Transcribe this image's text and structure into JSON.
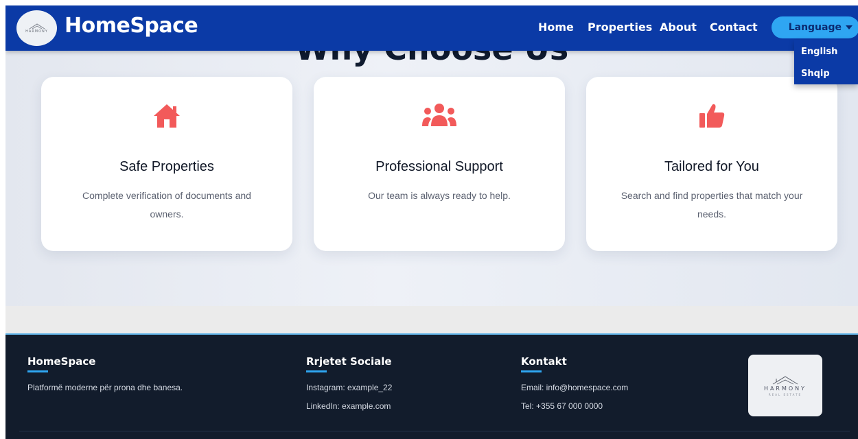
{
  "navbar": {
    "logo_text": "HARMONY",
    "brand": "HomeSpace",
    "links": [
      "Home",
      "Properties",
      "About",
      "Contact"
    ],
    "language_button": "Language",
    "language_options": [
      "English",
      "Shqip"
    ]
  },
  "section": {
    "title": "Why Choose Us",
    "cards": [
      {
        "icon": "home-icon",
        "title": "Safe Properties",
        "description": "Complete verification of documents and owners."
      },
      {
        "icon": "users-icon",
        "title": "Professional Support",
        "description": "Our team is always ready to help."
      },
      {
        "icon": "thumbs-up-icon",
        "title": "Tailored for You",
        "description": "Search and find properties that match your needs."
      }
    ]
  },
  "footer": {
    "col1": {
      "heading": "HomeSpace",
      "text": "Platformë moderne për prona dhe banesa."
    },
    "col2": {
      "heading": "Rrjetet Sociale",
      "lines": [
        "Instagram: example_22",
        "LinkedIn: example.com"
      ]
    },
    "col3": {
      "heading": "Kontakt",
      "lines": [
        "Email: info@homespace.com",
        "Tel: +355 67 000 0000"
      ]
    },
    "logo": {
      "name": "HARMONY",
      "subtitle": "REAL ESTATE"
    }
  },
  "colors": {
    "primary": "#0b3aa6",
    "accent": "#2fa6f2",
    "icon": "#f25a5a",
    "footer": "#121c2c"
  }
}
